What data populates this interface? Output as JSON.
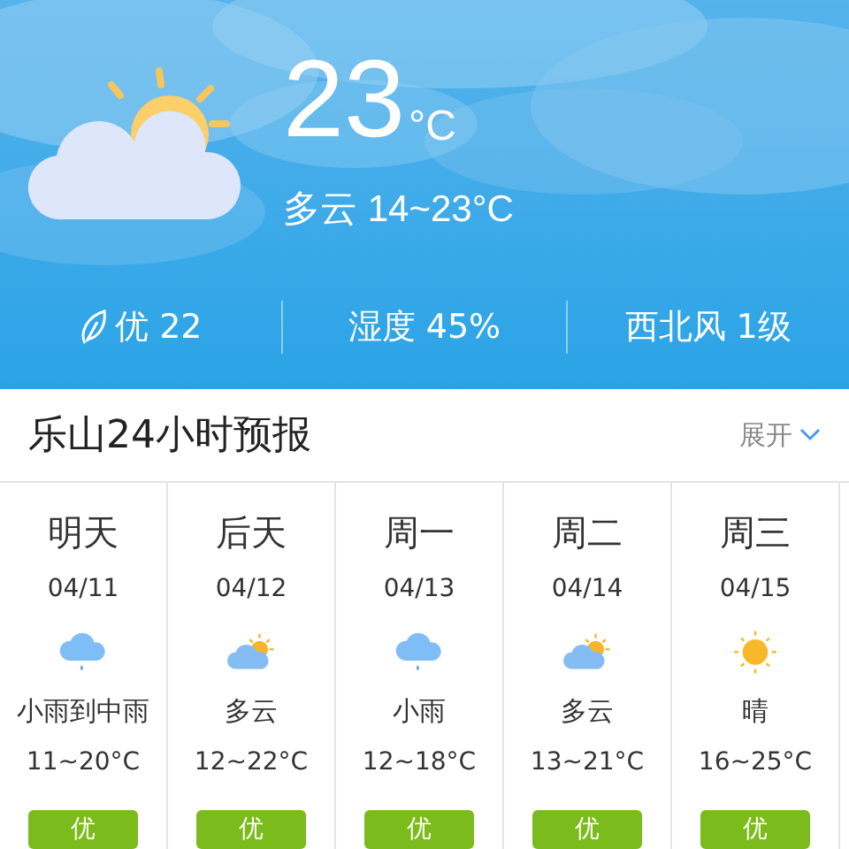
{
  "current": {
    "kind": "partly_cloudy",
    "temperature": "23",
    "unit": "°C",
    "condition": "多云 14~23°C"
  },
  "stats": [
    {
      "kind": "air",
      "text": "优 22"
    },
    {
      "kind": "plain",
      "text": "湿度 45%"
    },
    {
      "kind": "plain",
      "text": "西北风 1级"
    }
  ],
  "forecast_header": {
    "title": "乐山24小时预报",
    "toggle": "展开"
  },
  "days": [
    {
      "day": "明天",
      "date": "04/11",
      "kind": "rain",
      "condition": "小雨到中雨",
      "temps": "11~20°C",
      "air": "优"
    },
    {
      "day": "后天",
      "date": "04/12",
      "kind": "partly_cloudy",
      "condition": "多云",
      "temps": "12~22°C",
      "air": "优"
    },
    {
      "day": "周一",
      "date": "04/13",
      "kind": "rain",
      "condition": "小雨",
      "temps": "12~18°C",
      "air": "优"
    },
    {
      "day": "周二",
      "date": "04/14",
      "kind": "partly_cloudy",
      "condition": "多云",
      "temps": "13~21°C",
      "air": "优"
    },
    {
      "day": "周三",
      "date": "04/15",
      "kind": "sunny",
      "condition": "晴",
      "temps": "16~25°C",
      "air": "优"
    }
  ]
}
